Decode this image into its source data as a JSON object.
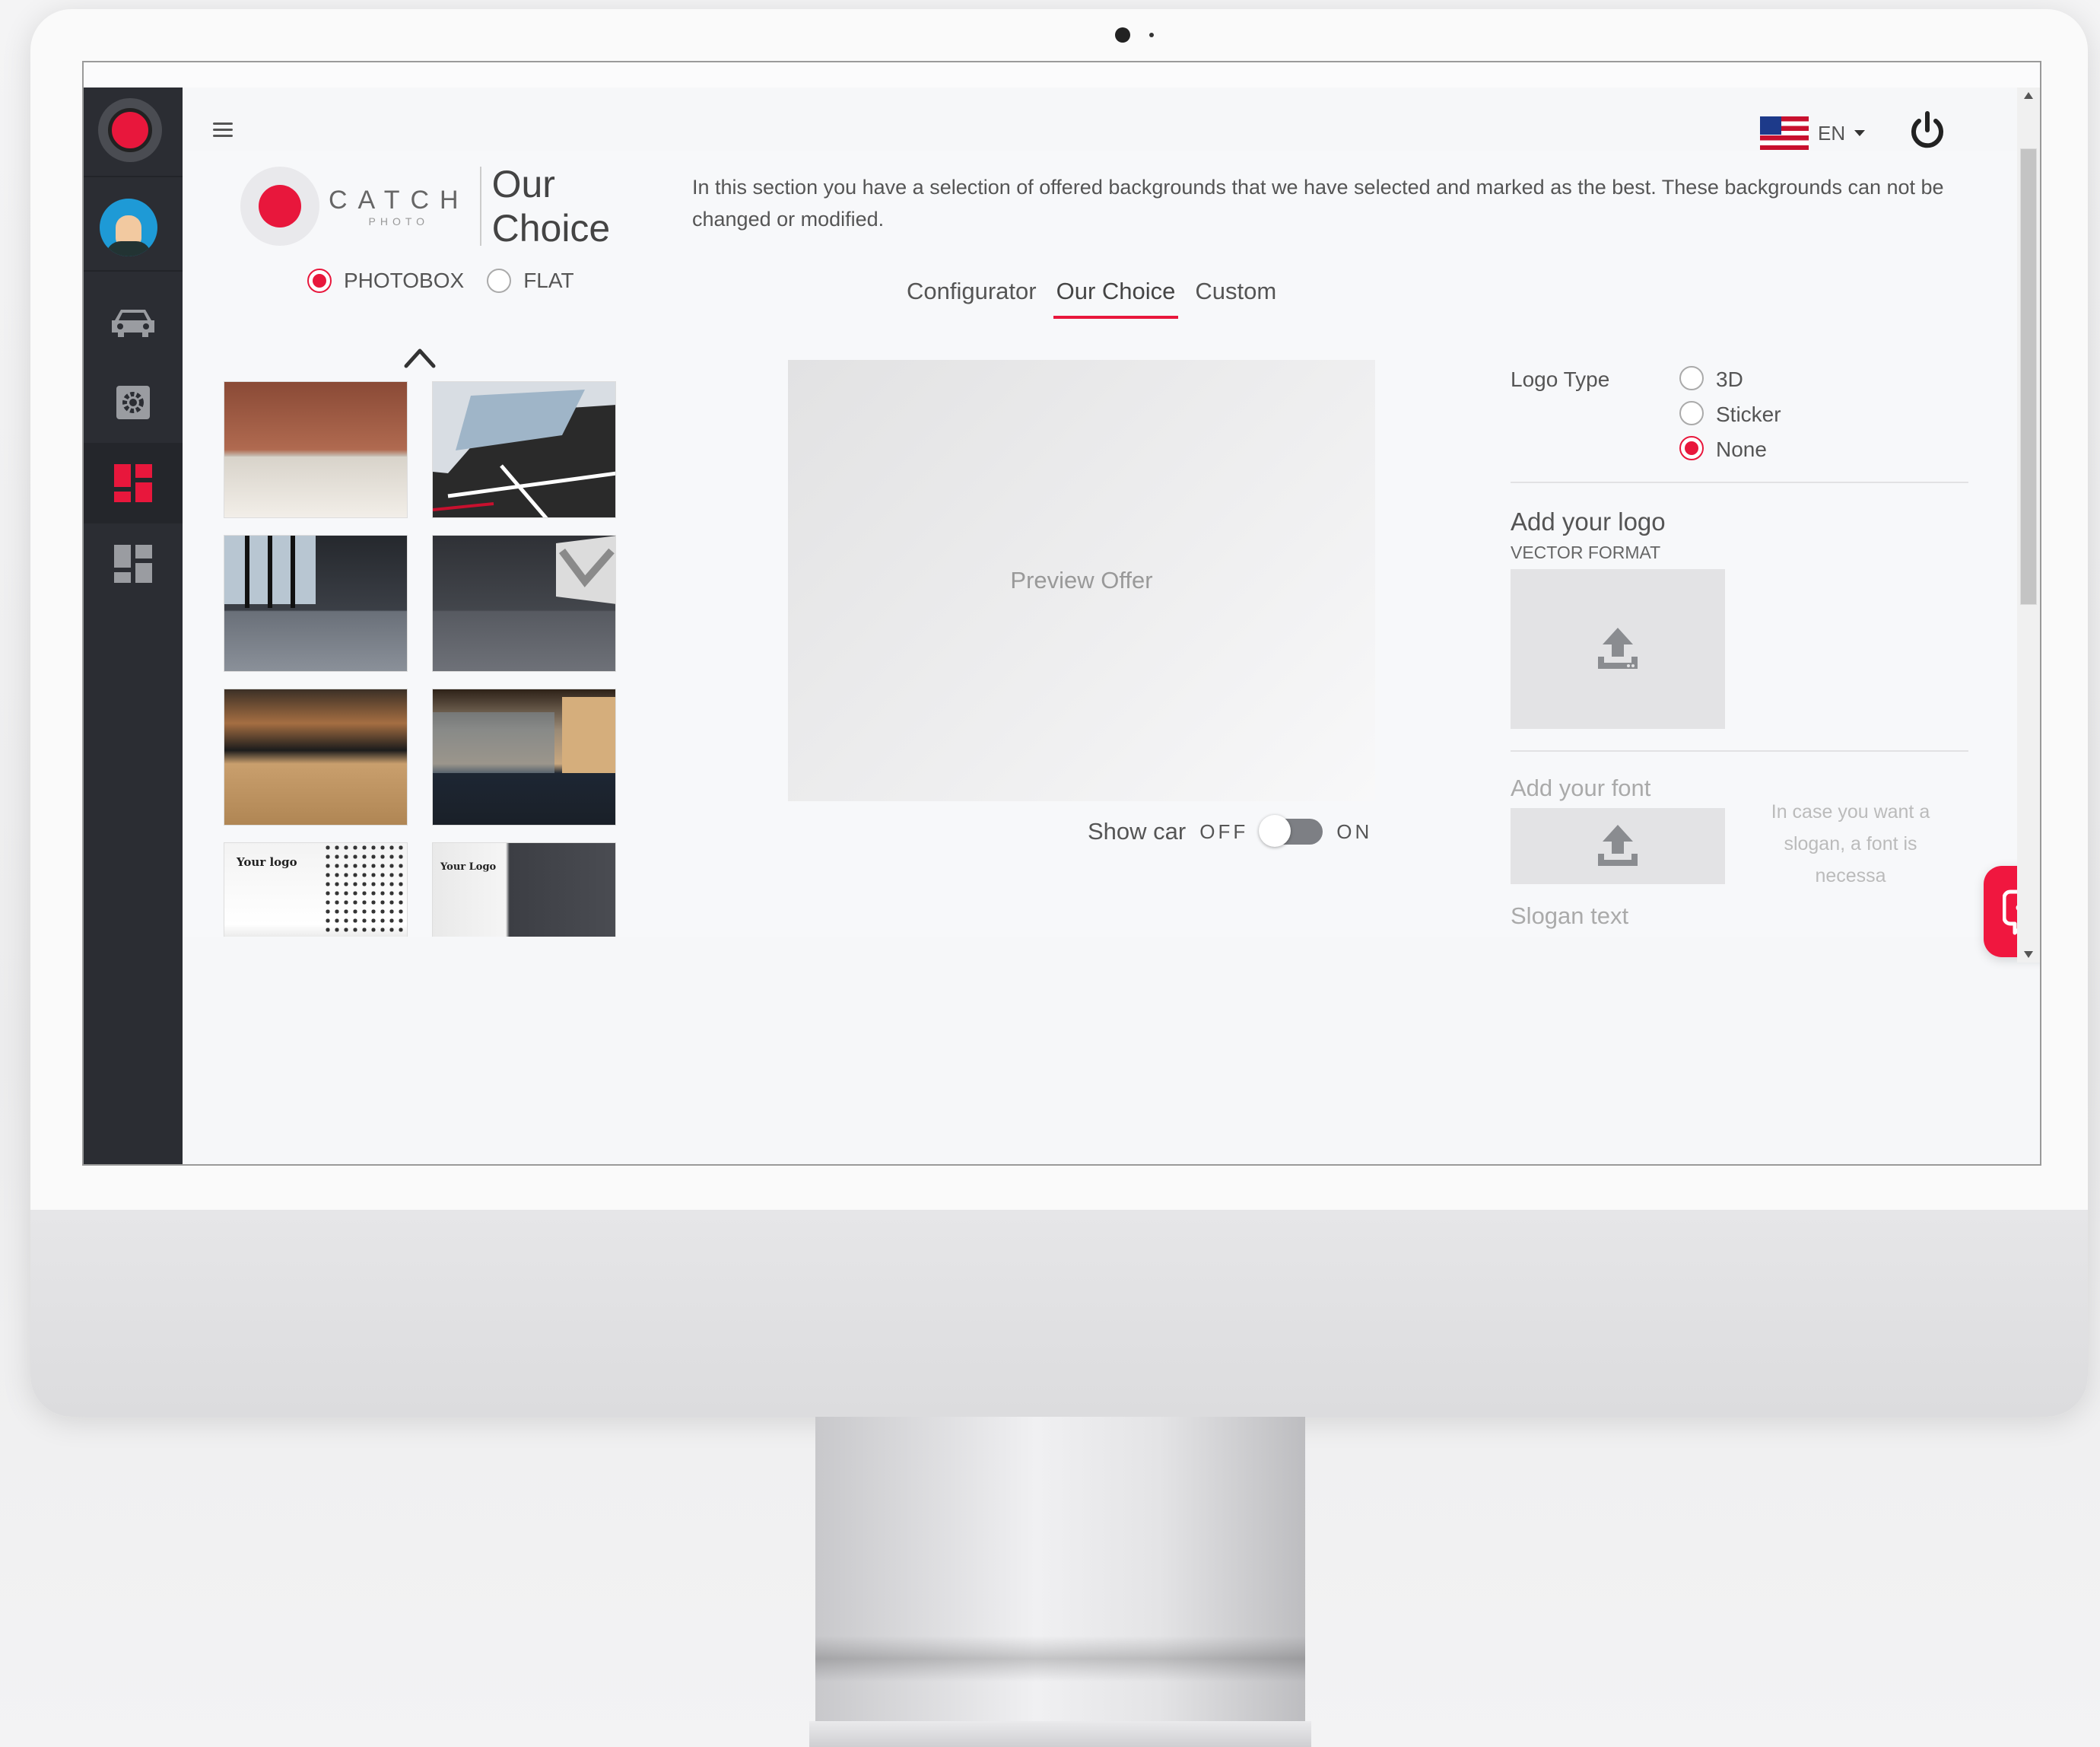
{
  "app": {
    "brand_word": "CATCH",
    "brand_sub": "PHOTO",
    "brand_title_line1": "Our",
    "brand_title_line2": "Choice"
  },
  "header": {
    "language": "EN",
    "menu_icon": "hamburger-icon",
    "power_icon": "power-icon",
    "flag_icon": "us-flag-icon"
  },
  "sidebar": {
    "items": [
      {
        "icon": "car-icon",
        "active": false
      },
      {
        "icon": "gear-icon",
        "active": false
      },
      {
        "icon": "dashboard-icon",
        "active": true
      },
      {
        "icon": "dashboard-outline-icon",
        "active": false
      }
    ]
  },
  "description": "In this section you have a selection of offered backgrounds that we have selected and marked as the best. These backgrounds can not be changed or modified.",
  "mode": {
    "options": [
      {
        "label": "PHOTOBOX",
        "selected": true
      },
      {
        "label": "FLAT",
        "selected": false
      }
    ]
  },
  "tabs": [
    {
      "label": "Configurator",
      "active": false
    },
    {
      "label": "Our Choice",
      "active": true
    },
    {
      "label": "Custom",
      "active": false
    }
  ],
  "thumbnails": [
    {
      "label": ""
    },
    {
      "label": ""
    },
    {
      "label": ""
    },
    {
      "label": ""
    },
    {
      "label": ""
    },
    {
      "label": ""
    },
    {
      "label": "Your logo"
    },
    {
      "label": "Your Logo"
    }
  ],
  "preview": {
    "placeholder": "Preview Offer",
    "show_car_label": "Show car",
    "off_label": "OFF",
    "on_label": "ON",
    "show_car_on": false
  },
  "logo_settings": {
    "logo_type_label": "Logo Type",
    "logo_type_options": [
      {
        "label": "3D",
        "selected": false
      },
      {
        "label": "Sticker",
        "selected": false
      },
      {
        "label": "None",
        "selected": true
      }
    ],
    "add_logo_title": "Add your logo",
    "add_logo_sub": "VECTOR FORMAT",
    "add_font_title": "Add your font",
    "font_hint": "In case you want a slogan, a font is necessa",
    "slogan_label": "Slogan text"
  },
  "colors": {
    "accent": "#e8173c",
    "sidebar_bg": "#2b2d33",
    "chat_button": "#f0173f"
  }
}
